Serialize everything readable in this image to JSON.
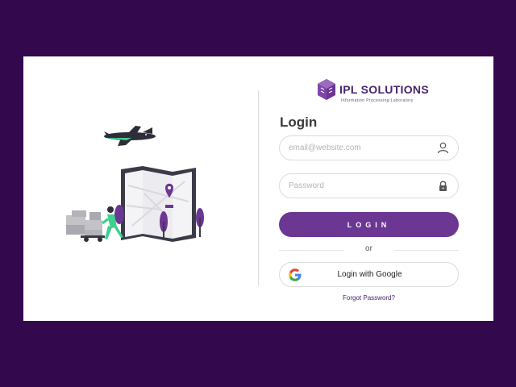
{
  "brand": {
    "name": "IPL SOLUTIONS",
    "tagline": "Information Processing Laboratory",
    "logo_icon": "cube-logo-icon",
    "accent_color": "#6c3693"
  },
  "login": {
    "title": "Login",
    "email_placeholder": "email@website.com",
    "email_value": "",
    "email_icon": "user-icon",
    "password_placeholder": "Password",
    "password_value": "",
    "password_icon": "lock-icon",
    "submit_label": "LOGIN",
    "separator_text": "or",
    "google_label": "Login with Google",
    "google_icon": "google-icon",
    "forgot_label": "Forgot Password?"
  },
  "colors": {
    "page_background": "#33084d",
    "card_background": "#ffffff",
    "button_background": "#6c3693",
    "illustration_green": "#3fcf8e"
  }
}
